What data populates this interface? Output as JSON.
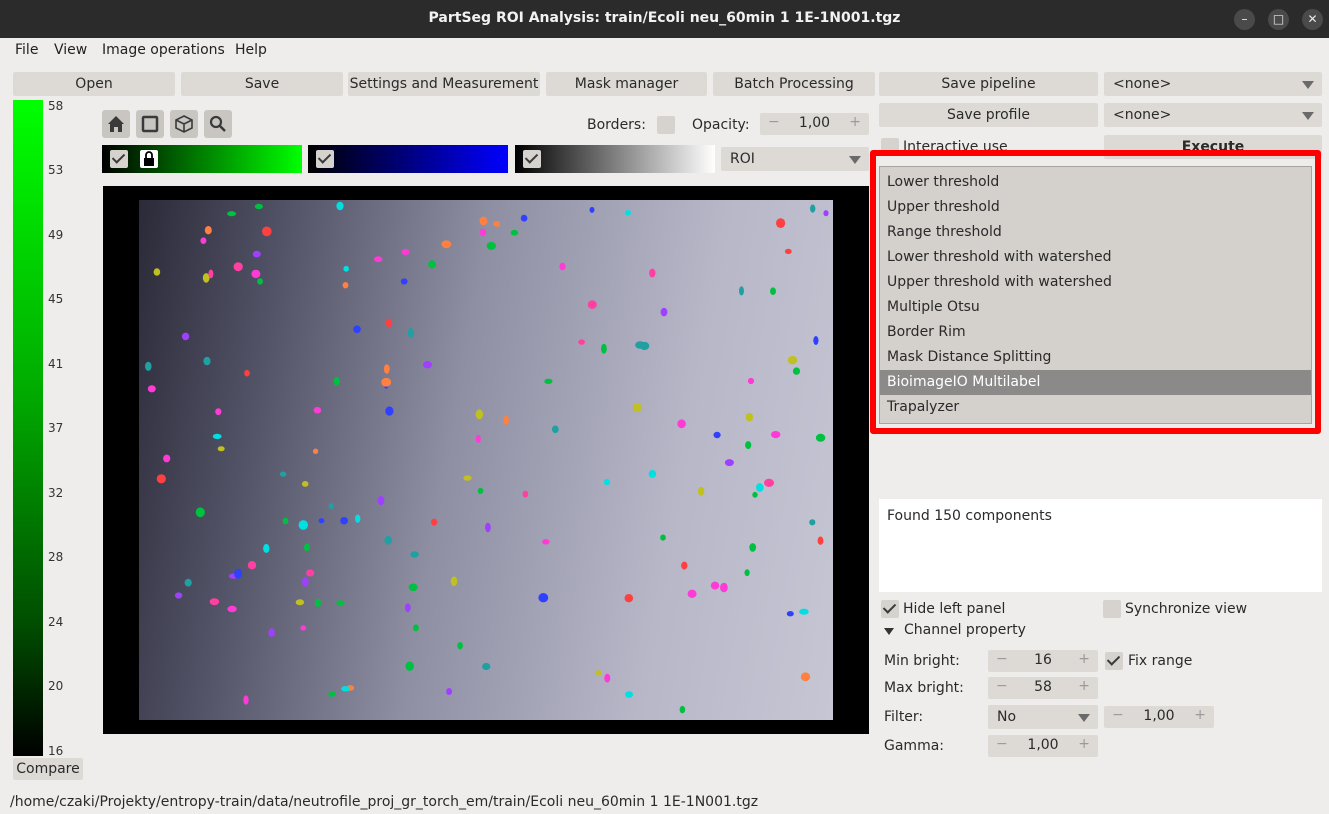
{
  "window": {
    "title": "PartSeg ROI Analysis: train/Ecoli neu_60min 1 1E-1N001.tgz",
    "minimize_glyph": "–",
    "maximize_glyph": "□",
    "close_glyph": "✕"
  },
  "menu": [
    "File",
    "View",
    "Image operations",
    "Help"
  ],
  "toolbar": {
    "open": "Open",
    "save": "Save",
    "settings": "Settings and Measurement",
    "mask_manager": "Mask manager",
    "batch": "Batch Processing",
    "save_pipeline": "Save pipeline",
    "save_profile": "Save profile",
    "pipeline_select": "<none>",
    "profile_select": "<none>"
  },
  "colorbar": {
    "ticks": [
      "58",
      "53",
      "49",
      "45",
      "41",
      "37",
      "32",
      "28",
      "24",
      "20",
      "16"
    ],
    "compare": "Compare"
  },
  "view_controls": {
    "borders_label": "Borders:",
    "opacity_label": "Opacity:",
    "opacity_value": "1,00",
    "roi_select": "ROI"
  },
  "right_panel": {
    "interactive_use": "Interactive use",
    "execute": "Execute",
    "algorithm_options": [
      "Lower threshold",
      "Upper threshold",
      "Range threshold",
      "Lower threshold with watershed",
      "Upper threshold with watershed",
      "Multiple Otsu",
      "Border Rim",
      "Mask Distance Splitting",
      "BioimageIO Multilabel",
      "Trapalyzer"
    ],
    "selected_algorithm": "BioimageIO Multilabel",
    "result_text": "Found 150 components",
    "hide_left_panel": "Hide left panel",
    "synchronize_view": "Synchronize view",
    "channel_property": "Channel property",
    "min_bright_label": "Min bright:",
    "min_bright_value": "16",
    "fix_range": "Fix range",
    "max_bright_label": "Max bright:",
    "max_bright_value": "58",
    "filter_label": "Filter:",
    "filter_value": "No",
    "filter_param": "1,00",
    "gamma_label": "Gamma:",
    "gamma_value": "1,00",
    "spin_minus": "−",
    "spin_plus": "+"
  },
  "status": {
    "path": "/home/czaki/Projekty/entropy-train/data/neutrofile_proj_gr_torch_em/train/Ecoli neu_60min 1 1E-1N001.tgz"
  },
  "colors": {
    "highlight": "#ff0000",
    "channel1": "#00ff00",
    "channel2": "#0000ff"
  }
}
